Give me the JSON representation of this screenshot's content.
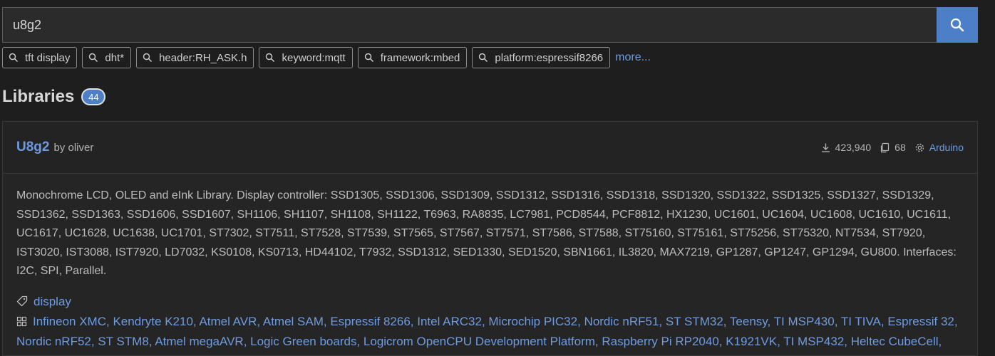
{
  "search": {
    "value": "u8g2"
  },
  "suggestions": [
    {
      "label": "tft display"
    },
    {
      "label": "dht*"
    },
    {
      "label": "header:RH_ASK.h"
    },
    {
      "label": "keyword:mqtt"
    },
    {
      "label": "framework:mbed"
    },
    {
      "label": "platform:espressif8266"
    }
  ],
  "more_label": "more...",
  "section": {
    "title": "Libraries",
    "count": "44"
  },
  "library": {
    "name": "U8g2",
    "by": "by oliver",
    "downloads": "423,940",
    "examples": "68",
    "platform": "Arduino",
    "description": "Monochrome LCD, OLED and eInk Library. Display controller: SSD1305, SSD1306, SSD1309, SSD1312, SSD1316, SSD1318, SSD1320, SSD1322, SSD1325, SSD1327, SSD1329, SSD1362, SSD1363, SSD1606, SSD1607, SH1106, SH1107, SH1108, SH1122, T6963, RA8835, LC7981, PCD8544, PCF8812, HX1230, UC1601, UC1604, UC1608, UC1610, UC1611, UC1617, UC1628, UC1638, UC1701, ST7302, ST7511, ST7528, ST7539, ST7565, ST7567, ST7571, ST7586, ST7588, ST75160, ST75161, ST75256, ST75320, NT7534, ST7920, IST3020, IST3088, IST7920, LD7032, KS0108, KS0713, HD44102, T7932, SSD1312, SED1330, SED1520, SBN1661, IL3820, MAX7219, GP1287, GP1247, GP1294, GU800. Interfaces: I2C, SPI, Parallel.",
    "keyword": "display",
    "frameworks": "Infineon XMC, Kendryte K210, Atmel AVR, Atmel SAM, Espressif 8266, Intel ARC32, Microchip PIC32, Nordic nRF51, ST STM32, Teensy, TI MSP430, TI TIVA, Espressif 32, Nordic nRF52, ST STM8, Atmel megaAVR, Logic Green boards, Logicrom OpenCPU Development Platform, Raspberry Pi RP2040, K1921VK, TI MSP432, Heltec CubeCell,"
  }
}
